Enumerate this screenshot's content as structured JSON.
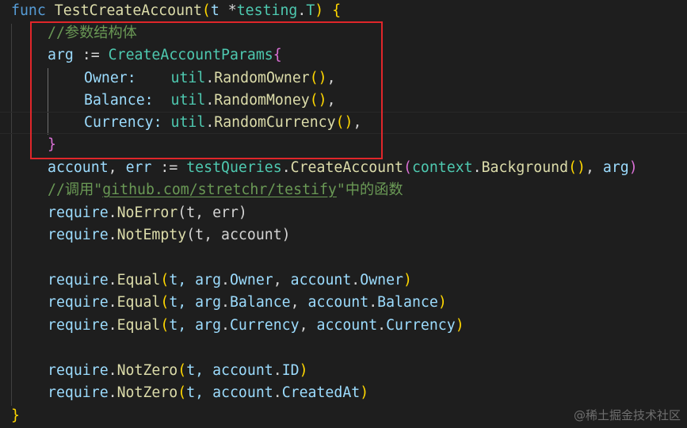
{
  "code": {
    "l1": {
      "kw": "func",
      "name": "TestCreateAccount",
      "open_paren": "(",
      "param": "t",
      "star": " *",
      "pkg": "testing",
      "dot": ".",
      "type": "T",
      "close_paren": ")",
      "brace": " {"
    },
    "l2": {
      "comment": "//参数结构体"
    },
    "l3": {
      "var": "arg",
      "op": " := ",
      "type": "CreateAccountParams",
      "brace": "{"
    },
    "l4": {
      "field": "Owner:",
      "pad": "    ",
      "pkg": "util",
      "dot": ".",
      "fn": "RandomOwner",
      "paren": "()",
      "comma": ","
    },
    "l5": {
      "field": "Balance:",
      "pad": "  ",
      "pkg": "util",
      "dot": ".",
      "fn": "RandomMoney",
      "paren": "()",
      "comma": ","
    },
    "l6": {
      "field": "Currency:",
      "pad": " ",
      "pkg": "util",
      "dot": ".",
      "fn": "RandomCurrency",
      "paren": "()",
      "comma": ","
    },
    "l7": {
      "brace": "}"
    },
    "l8": {
      "v1": "account",
      "comma": ", ",
      "v2": "err",
      "op": " := ",
      "obj": "testQueries",
      "dot": ".",
      "fn": "CreateAccount",
      "p_open": "(",
      "pkg": "context",
      "dot2": ".",
      "fn2": "Background",
      "paren2": "()",
      "comma2": ", ",
      "arg": "arg",
      "p_close": ")"
    },
    "l9": {
      "comment_pre": "//调用",
      "q1": "\"",
      "link": "github.com/stretchr/testify",
      "q2": "\"",
      "comment_post": "中的函数"
    },
    "l10": {
      "pkg": "require",
      "dot": ".",
      "fn": "NoError",
      "args": "(t, err)"
    },
    "l11": {
      "pkg": "require",
      "dot": ".",
      "fn": "NotEmpty",
      "args": "(t, account)"
    },
    "l13": {
      "pkg": "require",
      "dot": ".",
      "fn": "Equal",
      "p": "(",
      "a1": "t, ",
      "a2": "arg",
      "d1": ".",
      "f1": "Owner",
      "c": ", ",
      "a3": "account",
      "d2": ".",
      "f2": "Owner",
      "pc": ")"
    },
    "l14": {
      "pkg": "require",
      "dot": ".",
      "fn": "Equal",
      "p": "(",
      "a1": "t, ",
      "a2": "arg",
      "d1": ".",
      "f1": "Balance",
      "c": ", ",
      "a3": "account",
      "d2": ".",
      "f2": "Balance",
      "pc": ")"
    },
    "l15": {
      "pkg": "require",
      "dot": ".",
      "fn": "Equal",
      "p": "(",
      "a1": "t, ",
      "a2": "arg",
      "d1": ".",
      "f1": "Currency",
      "c": ", ",
      "a3": "account",
      "d2": ".",
      "f2": "Currency",
      "pc": ")"
    },
    "l17": {
      "pkg": "require",
      "dot": ".",
      "fn": "NotZero",
      "p": "(",
      "a1": "t, ",
      "a2": "account",
      "d": ".",
      "f": "ID",
      "pc": ")"
    },
    "l18": {
      "pkg": "require",
      "dot": ".",
      "fn": "NotZero",
      "p": "(",
      "a1": "t, ",
      "a2": "account",
      "d": ".",
      "f": "CreatedAt",
      "pc": ")"
    },
    "l19": {
      "brace": "}"
    }
  },
  "watermark": "@稀土掘金技术社区",
  "colors": {
    "highlight_box": "#e0262a",
    "background": "#1e1e1e"
  }
}
